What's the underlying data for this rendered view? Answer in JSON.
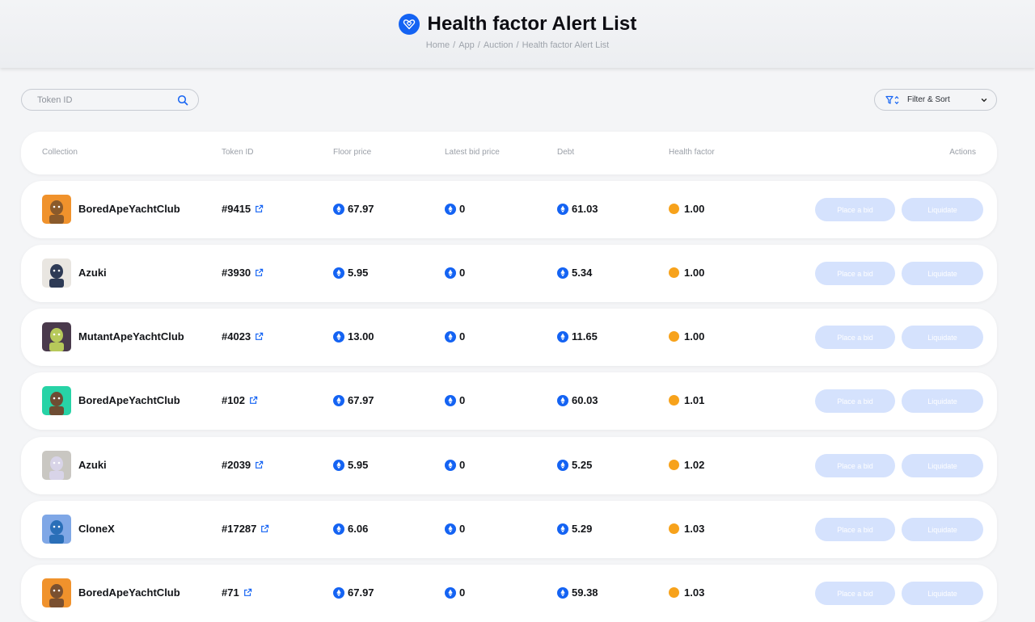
{
  "header": {
    "title": "Health factor Alert List",
    "icon": "heart-diamond-icon",
    "breadcrumb": [
      "Home",
      "App",
      "Auction",
      "Health factor Alert List"
    ]
  },
  "search": {
    "placeholder": "Token ID",
    "value": ""
  },
  "filter": {
    "label": "Filter & Sort"
  },
  "columns": {
    "collection": "Collection",
    "token_id": "Token ID",
    "floor_price": "Floor price",
    "latest_bid": "Latest bid price",
    "debt": "Debt",
    "health_factor": "Health factor",
    "actions": "Actions"
  },
  "actions": {
    "bid": "Place a bid",
    "liquidate": "Liquidate"
  },
  "colors": {
    "accent": "#1463f3",
    "health": "#f7a21b",
    "button_disabled": "#d5e2fd"
  },
  "rows": [
    {
      "collection": "BoredApeYachtClub",
      "token": "#9415",
      "floor": "67.97",
      "bid": "0",
      "debt": "61.03",
      "health": "1.00",
      "avatar_bg": "#f0922c",
      "avatar_fg": "#8a5a2b"
    },
    {
      "collection": "Azuki",
      "token": "#3930",
      "floor": "5.95",
      "bid": "0",
      "debt": "5.34",
      "health": "1.00",
      "avatar_bg": "#e9e6e1",
      "avatar_fg": "#2d3a55"
    },
    {
      "collection": "MutantApeYachtClub",
      "token": "#4023",
      "floor": "13.00",
      "bid": "0",
      "debt": "11.65",
      "health": "1.00",
      "avatar_bg": "#4a3a4c",
      "avatar_fg": "#b7c95a"
    },
    {
      "collection": "BoredApeYachtClub",
      "token": "#102",
      "floor": "67.97",
      "bid": "0",
      "debt": "60.03",
      "health": "1.01",
      "avatar_bg": "#27d3a6",
      "avatar_fg": "#6e4d33"
    },
    {
      "collection": "Azuki",
      "token": "#2039",
      "floor": "5.95",
      "bid": "0",
      "debt": "5.25",
      "health": "1.02",
      "avatar_bg": "#c9c7c2",
      "avatar_fg": "#d8d4e8"
    },
    {
      "collection": "CloneX",
      "token": "#17287",
      "floor": "6.06",
      "bid": "0",
      "debt": "5.29",
      "health": "1.03",
      "avatar_bg": "#7fa7e6",
      "avatar_fg": "#2a6fb8"
    },
    {
      "collection": "BoredApeYachtClub",
      "token": "#71",
      "floor": "67.97",
      "bid": "0",
      "debt": "59.38",
      "health": "1.03",
      "avatar_bg": "#f0922c",
      "avatar_fg": "#7a5030"
    }
  ]
}
